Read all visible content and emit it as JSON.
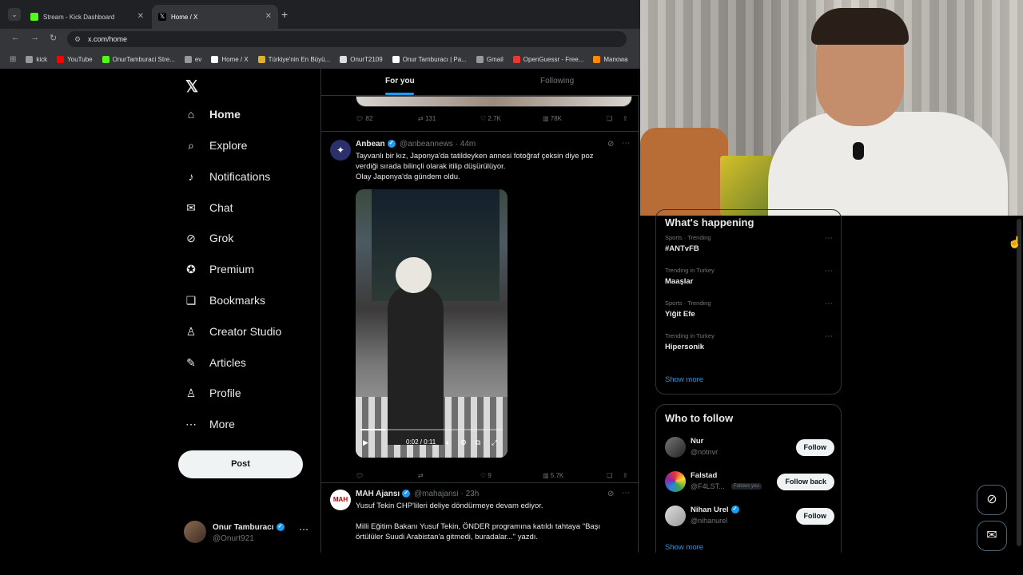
{
  "browser": {
    "tabs": [
      {
        "label": "Stream - Kick Dashboard",
        "favicon_color": "#53fc18"
      },
      {
        "label": "Home / X",
        "favicon_color": "#ffffff"
      }
    ],
    "url": "x.com/home",
    "bookmarks": [
      {
        "label": "kick",
        "color": "#999999"
      },
      {
        "label": "YouTube",
        "color": "#ff0000"
      },
      {
        "label": "OnurTamburaci Stre...",
        "color": "#53fc18"
      },
      {
        "label": "ev",
        "color": "#999999"
      },
      {
        "label": "Home / X",
        "color": "#ffffff"
      },
      {
        "label": "Türkiye'nin En Büyü...",
        "color": "#e0b030"
      },
      {
        "label": "OnurT2109",
        "color": "#dddddd"
      },
      {
        "label": "Onur Tamburacı | Pa...",
        "color": "#ffffff"
      },
      {
        "label": "Gmail",
        "color": "#999999"
      },
      {
        "label": "OpenGuessr - Free...",
        "color": "#e53935"
      },
      {
        "label": "Manowa",
        "color": "#ff8c00"
      }
    ]
  },
  "nav": {
    "logo": "X",
    "items": [
      {
        "label": "Home",
        "icon": "home-icon",
        "glyph": "⌂"
      },
      {
        "label": "Explore",
        "icon": "search-icon",
        "glyph": "⌕"
      },
      {
        "label": "Notifications",
        "icon": "bell-icon",
        "glyph": "♪"
      },
      {
        "label": "Chat",
        "icon": "mail-icon",
        "glyph": "✉"
      },
      {
        "label": "Grok",
        "icon": "grok-icon",
        "glyph": "⊘"
      },
      {
        "label": "Premium",
        "icon": "verified-icon",
        "glyph": "✪"
      },
      {
        "label": "Bookmarks",
        "icon": "bookmark-icon",
        "glyph": "❏"
      },
      {
        "label": "Creator Studio",
        "icon": "creator-icon",
        "glyph": "♙"
      },
      {
        "label": "Articles",
        "icon": "articles-icon",
        "glyph": "✎"
      },
      {
        "label": "Profile",
        "icon": "profile-icon",
        "glyph": "♙"
      },
      {
        "label": "More",
        "icon": "more-icon",
        "glyph": "⋯"
      }
    ],
    "post": "Post",
    "account": {
      "name": "Onur Tamburacı",
      "handle": "@Onurt921"
    }
  },
  "feed": {
    "tabs": [
      "For you",
      "Following"
    ],
    "prev_actions": {
      "reply": "82",
      "repost": "131",
      "like": "2.7K",
      "views": "78K"
    },
    "tweets": [
      {
        "name": "Anbean",
        "handle": "@anbeannews",
        "time": "44m",
        "text1": "Tayvanlı bir kız, Japonya'da tatildeyken annesi fotoğraf çeksin diye poz",
        "text2": "verdiği sırada bilinçli olarak itilip düşürülüyor.",
        "text3": "Olay Japonya'da gündem oldu.",
        "video_time": "0:02 / 0:11",
        "video_progress": 0.18,
        "actions": {
          "reply": "",
          "repost": "",
          "like": "9",
          "views": "5.7K"
        }
      },
      {
        "name": "MAH Ajansı",
        "handle": "@mahajansi",
        "time": "23h",
        "text1": "Yusuf Tekin CHP'lileri deliye döndürmeye devam ediyor.",
        "text2": "Milli Eğitim Bakanı Yusuf Tekin, ÖNDER programına katıldı tahtaya \"Başı",
        "text3": "örtülüler Suudi Arabistan'a gitmedi, buradalar...\" yazdı."
      }
    ]
  },
  "happening": {
    "title": "What's happening",
    "trends": [
      {
        "meta": "Sports · Trending",
        "name": "#ANTvFB"
      },
      {
        "meta": "Trending in Turkey",
        "name": "Maaşlar"
      },
      {
        "meta": "Sports · Trending",
        "name": "Yiğit Efe"
      },
      {
        "meta": "Trending in Turkey",
        "name": "Hipersonik"
      }
    ],
    "show_more": "Show more"
  },
  "who_to_follow": {
    "title": "Who to follow",
    "users": [
      {
        "name": "Nur",
        "handle": "@notnvr",
        "button": "Follow",
        "follows_you": ""
      },
      {
        "name": "Falstad",
        "handle": "@F4LST...",
        "button": "Follow back",
        "follows_you": "Follows you"
      },
      {
        "name": "Nihan Urel",
        "handle": "@nihanurel",
        "button": "Follow",
        "follows_you": ""
      }
    ],
    "show_more": "Show more"
  },
  "colors": {
    "accent": "#1d9bf0",
    "background": "#000000",
    "border": "#2f3336"
  }
}
